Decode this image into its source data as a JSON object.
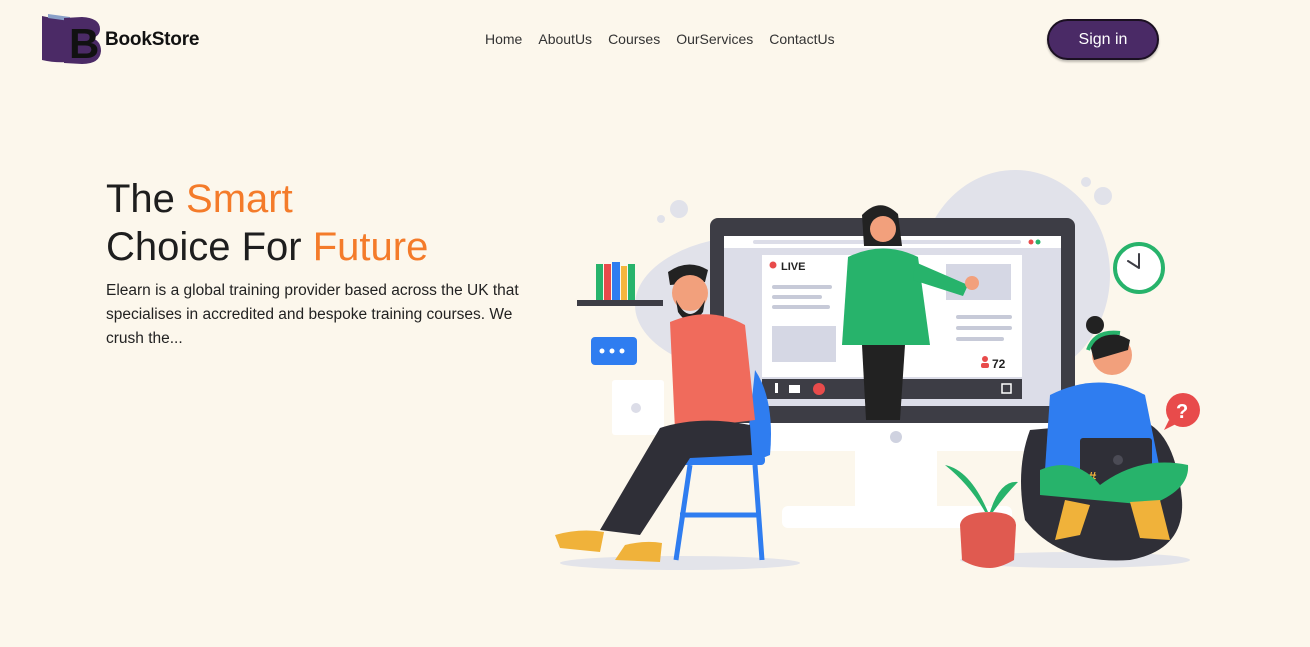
{
  "brand": {
    "logo_letter": "B",
    "name": "BookStore"
  },
  "nav": {
    "items": [
      {
        "label": "Home"
      },
      {
        "label": "AboutUs"
      },
      {
        "label": "Courses"
      },
      {
        "label": "OurServices"
      },
      {
        "label": "ContactUs"
      }
    ]
  },
  "header": {
    "signin_label": "Sign in"
  },
  "hero": {
    "title_line1_plain": "The ",
    "title_line1_accent": "Smart",
    "title_line2_plain": "Choice For ",
    "title_line2_accent": "Future",
    "description": "Elearn is a global training provider based across the UK that specialises in accredited and bespoke training courses. We crush the..."
  },
  "illustration": {
    "live_label": "LIVE",
    "viewer_count": "72",
    "hashtag": "#",
    "help_mark": "?"
  },
  "colors": {
    "background": "#fcf7ec",
    "accent": "#f47b2a",
    "brand": "#4a2a66"
  },
  "icons": [
    "book-logo-icon",
    "clock-icon",
    "question-icon",
    "chat-bubble-icon",
    "plant-icon",
    "bookshelf-icon"
  ]
}
